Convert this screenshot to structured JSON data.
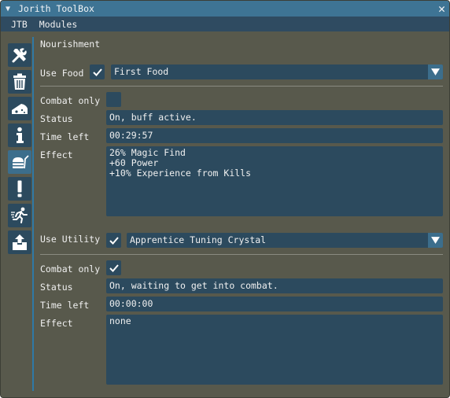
{
  "window": {
    "title": "Jorith ToolBox"
  },
  "menu": [
    "JTB",
    "Modules"
  ],
  "sidebar": {
    "icons": [
      "tools-icon",
      "trash-icon",
      "cheese-icon",
      "info-icon",
      "food-icon",
      "alert-icon",
      "runner-icon",
      "upload-box-icon"
    ],
    "active_index": 4
  },
  "section": {
    "title": "Nourishment"
  },
  "food": {
    "use_label": "Use Food",
    "use_checked": true,
    "selected": "First Food",
    "combat_only_label": "Combat only",
    "combat_only_checked": false,
    "status_label": "Status",
    "status_value": "On, buff active.",
    "time_left_label": "Time left",
    "time_left_value": "00:29:57",
    "effect_label": "Effect",
    "effect_lines": [
      "26% Magic Find",
      "+60 Power",
      "+10% Experience from Kills"
    ]
  },
  "utility": {
    "use_label": "Use Utility",
    "use_checked": true,
    "selected": "Apprentice Tuning Crystal",
    "combat_only_label": "Combat only",
    "combat_only_checked": true,
    "status_label": "Status",
    "status_value": "On, waiting to get into combat.",
    "time_left_label": "Time left",
    "time_left_value": "00:00:00",
    "effect_label": "Effect",
    "effect_lines": [
      "none"
    ]
  },
  "colors": {
    "title_bar": "#3e7494",
    "accent": "#2f79a6",
    "frame": "#2c4a5e",
    "background": "#58594c"
  }
}
